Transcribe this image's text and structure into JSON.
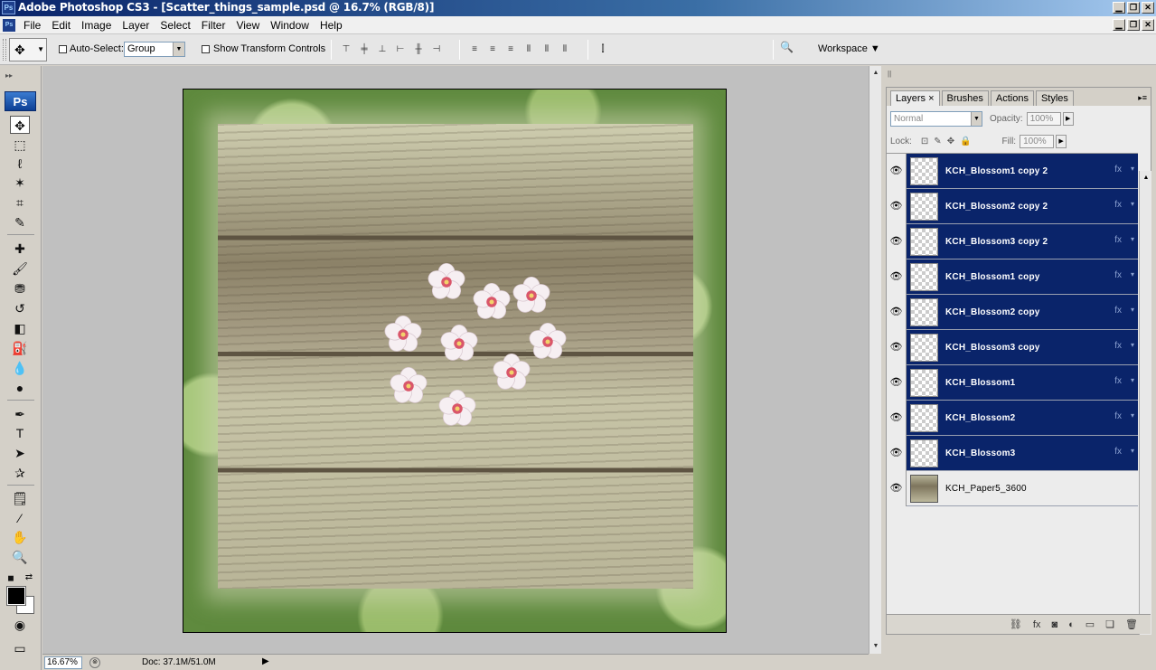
{
  "titlebar": {
    "title": "Adobe Photoshop CS3 - [Scatter_things_sample.psd @ 16.7% (RGB/8)]",
    "app_icon": "Ps"
  },
  "window_buttons": {
    "minimize": "▁",
    "restore": "❐",
    "close": "✕"
  },
  "menu": [
    "File",
    "Edit",
    "Image",
    "Layer",
    "Select",
    "Filter",
    "View",
    "Window",
    "Help"
  ],
  "options": {
    "auto_select_label": "Auto-Select:",
    "auto_select_value": "Group",
    "show_transform_label": "Show Transform Controls",
    "workspace_label": "Workspace ▼"
  },
  "tools": {
    "logo": "Ps",
    "items": [
      "move-tool",
      "marquee-tool",
      "lasso-tool",
      "magic-wand-tool",
      "crop-tool",
      "healing-brush-tool",
      "brush-tool",
      "clone-stamp-tool",
      "history-brush-tool",
      "eraser-tool",
      "paint-bucket-tool",
      "blur-tool",
      "dodge-tool",
      "pen-tool",
      "type-tool",
      "path-selection-tool",
      "shape-tool",
      "notes-tool",
      "eyedropper-tool",
      "hand-tool",
      "zoom-tool"
    ],
    "foreground_color": "#000000",
    "background_color": "#ffffff"
  },
  "status": {
    "zoom": "16.67%",
    "doc": "Doc: 37.1M/51.0M"
  },
  "layers_panel": {
    "tabs": [
      "Layers",
      "Brushes",
      "Actions",
      "Styles"
    ],
    "blend_mode": "Normal",
    "opacity_label": "Opacity:",
    "opacity_value": "100%",
    "lock_label": "Lock:",
    "fill_label": "Fill:",
    "fill_value": "100%",
    "layers": [
      {
        "name": "KCH_Blossom1 copy 2",
        "selected": true
      },
      {
        "name": "KCH_Blossom2 copy 2",
        "selected": true
      },
      {
        "name": "KCH_Blossom3 copy 2",
        "selected": true
      },
      {
        "name": "KCH_Blossom1 copy",
        "selected": true
      },
      {
        "name": "KCH_Blossom2 copy",
        "selected": true
      },
      {
        "name": "KCH_Blossom3 copy",
        "selected": true
      },
      {
        "name": "KCH_Blossom1",
        "selected": true
      },
      {
        "name": "KCH_Blossom2",
        "selected": true
      },
      {
        "name": "KCH_Blossom3",
        "selected": true
      },
      {
        "name": "KCH_Paper5_3600",
        "selected": false
      }
    ]
  },
  "colors": {
    "selection": "#0a246a",
    "canvas_bg": "#c0c0c0",
    "chrome": "#d4d0c8"
  }
}
